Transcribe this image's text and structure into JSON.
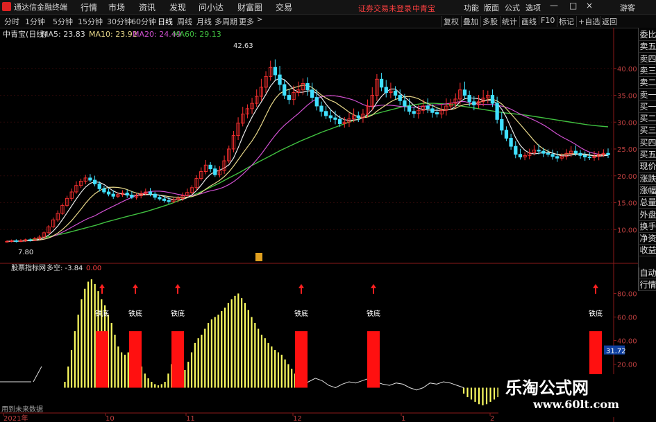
{
  "app": {
    "title": "通达信金融终端",
    "menu": [
      "行情",
      "市场",
      "资讯",
      "发现",
      "问小达",
      "财富圈",
      "交易"
    ],
    "notice": "证券交易未登录",
    "stock_tag": "中青宝",
    "right_menu": [
      "功能",
      "版面",
      "公式",
      "选项"
    ],
    "guest": "游客"
  },
  "periods": [
    "分时",
    "1分钟",
    "5分钟",
    "15分钟",
    "30分钟",
    "60分钟",
    "日线",
    "周线",
    "月线",
    "多周期",
    "更多"
  ],
  "active_period": "日线",
  "tools": [
    "复权",
    "叠加",
    "多股",
    "统计",
    "画线",
    "F10",
    "标记",
    "+自选",
    "返回"
  ],
  "right_tabs": [
    "委比",
    "卖五",
    "卖四",
    "卖三",
    "卖二",
    "卖一",
    "买一",
    "买二",
    "买三",
    "买四",
    "买五",
    "现价",
    "涨跌",
    "涨幅",
    "总量",
    "外盘",
    "换手",
    "净资",
    "收益"
  ],
  "right_tabs_lower": [
    "自动",
    "行情"
  ],
  "main_header": {
    "name": "中青宝(日线)",
    "ma5": "MA5: 23.83",
    "ma10": "MA10: 23.92",
    "ma20": "MA20: 24.49",
    "ma60": "MA60: 29.13"
  },
  "ind_header": {
    "name": "股票指标网",
    "label": "多空: -3.84",
    "value": "0.00"
  },
  "peak_label": "42.63",
  "low_label": "7.80",
  "buy_label": "铁底",
  "future_note": "用到未来数据",
  "date_labels": [
    {
      "text": "2021年",
      "x": 5
    },
    {
      "text": "10",
      "x": 152
    },
    {
      "text": "11",
      "x": 268
    },
    {
      "text": "12",
      "x": 422
    },
    {
      "text": "1",
      "x": 578
    },
    {
      "text": "2",
      "x": 706
    }
  ],
  "price_axis": [
    "40.00",
    "35.00",
    "30.00",
    "25.00",
    "20.00",
    "15.00",
    "10.00"
  ],
  "ind_axis": [
    "80.00",
    "60.00",
    "40.00",
    "20.00"
  ],
  "ind_current": "31.72",
  "watermark": {
    "title": "乐淘公式网",
    "url": "www.60lt.com"
  },
  "colors": {
    "up": "#ff3030",
    "down": "#40e0ff",
    "ma5": "#e8e8e8",
    "ma10": "#e8d88a",
    "ma20": "#d050d0",
    "ma60": "#40c040",
    "bar_yellow": "#ffff60",
    "bar_red": "#ff1010",
    "arrow": "#ff2020"
  },
  "chart_data": {
    "type": "candlestick",
    "title": "中青宝(日线)",
    "ylim": [
      5,
      45
    ],
    "closes": [
      7.8,
      7.9,
      7.8,
      7.9,
      8.1,
      8.0,
      8.3,
      8.6,
      9.4,
      10.5,
      11.8,
      13.0,
      14.5,
      15.8,
      17.0,
      18.2,
      19.0,
      19.6,
      19.2,
      18.5,
      17.6,
      17.0,
      16.6,
      16.2,
      16.5,
      16.8,
      16.4,
      16.0,
      16.3,
      16.7,
      17.0,
      16.6,
      16.0,
      15.7,
      15.4,
      15.2,
      15.5,
      15.8,
      16.3,
      16.9,
      17.8,
      19.5,
      20.8,
      22.0,
      21.3,
      20.2,
      21.0,
      22.8,
      25.0,
      27.5,
      29.8,
      31.5,
      32.5,
      33.5,
      34.8,
      36.5,
      38.5,
      40.2,
      38.8,
      37.0,
      35.0,
      34.2,
      35.5,
      36.0,
      37.2,
      36.0,
      34.6,
      33.0,
      32.0,
      31.2,
      30.8,
      30.5,
      29.7,
      30.0,
      30.6,
      31.2,
      30.8,
      31.5,
      33.0,
      35.0,
      38.0,
      36.5,
      35.5,
      35.8,
      35.0,
      34.0,
      33.0,
      32.0,
      31.6,
      32.2,
      33.0,
      32.5,
      31.8,
      31.5,
      32.2,
      33.0,
      33.5,
      34.3,
      36.0,
      35.0,
      33.8,
      33.2,
      33.8,
      34.5,
      35.0,
      33.5,
      30.5,
      28.5,
      27.0,
      25.5,
      24.0,
      23.5,
      23.8,
      24.3,
      24.8,
      24.6,
      24.2,
      24.0,
      23.6,
      23.3,
      23.6,
      24.2,
      24.6,
      24.2,
      23.8,
      23.5,
      23.4,
      23.6,
      24.0,
      24.2,
      23.9
    ],
    "ma60": [
      7.8,
      7.9,
      8.2,
      8.5,
      8.9,
      9.3,
      9.8,
      10.3,
      10.8,
      11.4,
      11.9,
      12.4,
      12.9,
      13.4,
      14.0,
      14.6,
      15.3,
      16.0,
      16.8,
      17.7,
      18.6,
      19.6,
      20.6,
      21.7,
      22.7,
      23.7,
      24.7,
      25.6,
      26.5,
      27.3,
      28.1,
      28.8,
      29.5,
      30.2,
      30.8,
      31.4,
      31.9,
      32.4,
      32.9,
      33.2,
      33.5,
      33.5,
      33.4,
      33.2,
      32.9,
      32.6,
      32.3,
      32.0,
      31.7,
      31.5,
      31.3,
      31.0,
      30.7,
      30.4,
      30.1,
      29.8,
      29.5,
      29.3,
      29.13
    ],
    "indicator": {
      "name": "多空",
      "ylim": [
        -15,
        95
      ],
      "bars": [
        0,
        0,
        0,
        0,
        0,
        0,
        0,
        0,
        5,
        18,
        32,
        48,
        62,
        75,
        84,
        90,
        92,
        88,
        82,
        75,
        70,
        62,
        55,
        45,
        35,
        30,
        28,
        30,
        28,
        25,
        22,
        18,
        12,
        8,
        5,
        3,
        2,
        3,
        5,
        12,
        20,
        25,
        22,
        18,
        15,
        22,
        30,
        38,
        42,
        45,
        50,
        55,
        58,
        60,
        62,
        65,
        68,
        72,
        75,
        78,
        80,
        76,
        72,
        66,
        60,
        55,
        50,
        45,
        42,
        38,
        35,
        32,
        30,
        28,
        24,
        20,
        16,
        12
      ],
      "neg_bars": [
        -5,
        -8,
        -10,
        -12,
        -14,
        -15,
        -14,
        -12,
        -10,
        -8
      ],
      "white_line": [
        5,
        5,
        5,
        5,
        5,
        5,
        5,
        5,
        5,
        5,
        3,
        2,
        5,
        8,
        6,
        2,
        0,
        3,
        5,
        4,
        6,
        8,
        5,
        3,
        2,
        4,
        3,
        0,
        -2,
        0,
        4,
        3,
        5,
        4,
        2,
        0
      ],
      "signals": [
        "铁底",
        "铁底",
        "铁底",
        "铁底",
        "铁底",
        "铁底"
      ],
      "current": 31.72
    }
  }
}
